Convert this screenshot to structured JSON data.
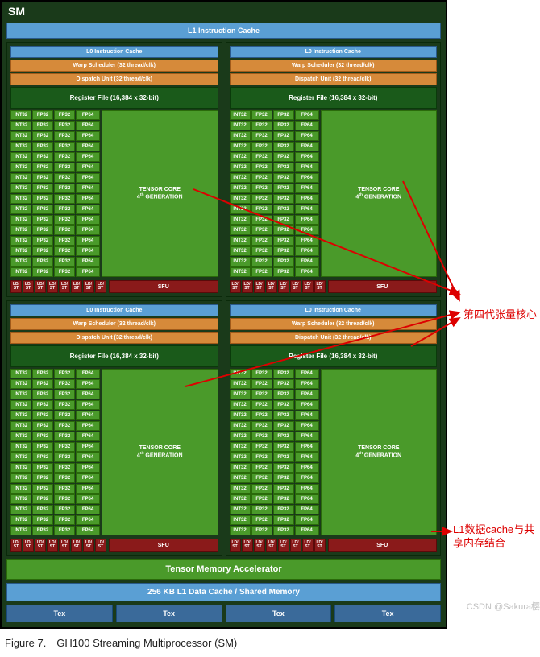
{
  "sm_title": "SM",
  "l1_icache": "L1 Instruction Cache",
  "quad": {
    "l0_icache": "L0 Instruction Cache",
    "warp_scheduler": "Warp Scheduler (32 thread/clk)",
    "dispatch_unit": "Dispatch Unit (32 thread/clk)",
    "register_file": "Register File (16,384 x 32-bit)",
    "int32": "INT32",
    "fp32": "FP32",
    "fp64": "FP64",
    "tensor_core_l1": "TENSOR CORE",
    "tensor_core_l2": "4ᵗʰ GENERATION",
    "ldst": "LD/\nST",
    "sfu": "SFU",
    "rows": 16,
    "ldst_count": 8
  },
  "tma": "Tensor Memory Accelerator",
  "l1_dcache": "256 KB L1 Data Cache / Shared Memory",
  "tex": "Tex",
  "caption": "Figure 7. GH100 Streaming Multiprocessor (SM)",
  "annotations": {
    "tensor_label": "第四代张量核心",
    "l1_label": "L1数据cache与共享内存结合"
  },
  "watermark": "CSDN @Sakura樱"
}
